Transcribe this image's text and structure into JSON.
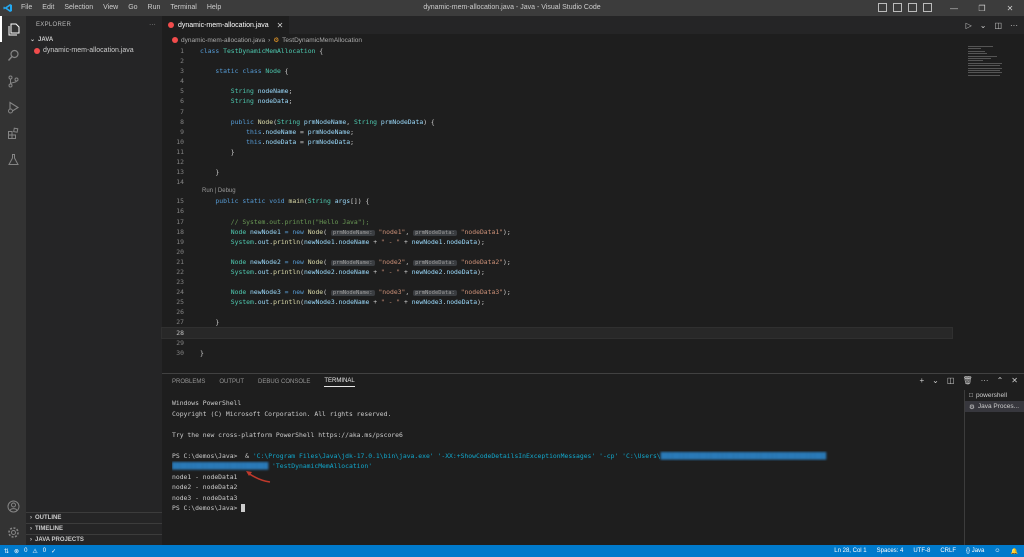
{
  "titlebar": {
    "menu": [
      "File",
      "Edit",
      "Selection",
      "View",
      "Go",
      "Run",
      "Terminal",
      "Help"
    ],
    "title": "dynamic-mem-allocation.java - Java - Visual Studio Code"
  },
  "sidebar": {
    "header": "EXPLORER",
    "section": "JAVA",
    "file": "dynamic-mem-allocation.java",
    "bottom_sections": [
      "OUTLINE",
      "TIMELINE",
      "JAVA PROJECTS"
    ]
  },
  "editor": {
    "tab_label": "dynamic-mem-allocation.java",
    "breadcrumb": [
      "dynamic-mem-allocation.java",
      "TestDynamicMemAllocation"
    ],
    "codelens": "Run | Debug",
    "line_numbers": [
      "1",
      "2",
      "3",
      "4",
      "5",
      "6",
      "7",
      "8",
      "9",
      "10",
      "11",
      "12",
      "13",
      "14",
      "15",
      "16",
      "17",
      "18",
      "19",
      "20",
      "21",
      "22",
      "23",
      "24",
      "25",
      "26",
      "27",
      "28",
      "29",
      "30"
    ],
    "code": {
      "l1a": "class ",
      "l1b": "TestDynamicMemAllocation",
      "l1c": " {",
      "l3a": "    static class ",
      "l3b": "Node",
      "l3c": " {",
      "l5a": "        String ",
      "l5b": "nodeName",
      "l5c": ";",
      "l6a": "        String ",
      "l6b": "nodeData",
      "l6c": ";",
      "l8a": "        public ",
      "l8b": "Node",
      "l8c": "(",
      "l8d": "String ",
      "l8e": "prmNodeName",
      "l8f": ", ",
      "l8g": "String ",
      "l8h": "prmNodeData",
      "l8i": ") {",
      "l9a": "            this",
      "l9b": ".",
      "l9c": "nodeName",
      "l9d": " = ",
      "l9e": "prmNodeName",
      "l9f": ";",
      "l10a": "            this",
      "l10b": ".",
      "l10c": "nodeData",
      "l10d": " = ",
      "l10e": "prmNodeData",
      "l10f": ";",
      "l11": "        }",
      "l13": "    }",
      "l15a": "    public static void ",
      "l15b": "main",
      "l15c": "(",
      "l15d": "String ",
      "l15e": "args",
      "l15f": "[]) {",
      "l17": "        // System.out.println(\"Hello Java\");",
      "hint_name": "prmNodeName:",
      "hint_data": "prmNodeData:",
      "l18a": "        Node ",
      "l18b": "newNode1",
      "l18c": " = new ",
      "l18d": "Node",
      "l18e": "( ",
      "l18f": "\"node1\"",
      "l18g": ", ",
      "l18h": "\"nodeData1\"",
      "l18i": ");",
      "l19a": "        System",
      "l19b": ".",
      "l19c": "out",
      "l19d": ".",
      "l19e": "println",
      "l19f": "(",
      "l19g": "newNode1",
      "l19h": ".",
      "l19i": "nodeName",
      "l19j": " + ",
      "l19k": "\" - \"",
      "l19l": " + ",
      "l19m": "newNode1",
      "l19n": ".",
      "l19o": "nodeData",
      "l19p": ");",
      "l21b": "newNode2",
      "l21f": "\"node2\"",
      "l21h": "\"nodeData2\"",
      "l22g": "newNode2",
      "l22m": "newNode2",
      "l24b": "newNode3",
      "l24f": "\"node3\"",
      "l24h": "\"nodeData3\"",
      "l25g": "newNode3",
      "l25m": "newNode3",
      "l27": "    }",
      "l30": "}"
    }
  },
  "panel": {
    "tabs": [
      "PROBLEMS",
      "OUTPUT",
      "DEBUG CONSOLE",
      "TERMINAL"
    ],
    "terminal_list": [
      "powershell",
      "Java Proces..."
    ],
    "terminal": {
      "l1": "Windows PowerShell",
      "l2": "Copyright (C) Microsoft Corporation. All rights reserved.",
      "l3": "Try the new cross-platform PowerShell https://aka.ms/pscore6",
      "prompt": "PS C:\\demos\\Java>",
      "cmd_amp": "  & ",
      "cmd_java": "'C:\\Program Files\\Java\\jdk-17.0.1\\bin\\java.exe'",
      "cmd_flags": " '-XX:+ShowCodeDetailsInExceptionMessages' '-cp' 'C:\\Users\\",
      "cmd_class": " 'TestDynamicMemAllocation'",
      "out1": "node1 - nodeData1",
      "out2": "node2 - nodeData2",
      "out3": "node3 - nodeData3",
      "prompt2": "PS C:\\demos\\Java> "
    }
  },
  "statusbar": {
    "left": [
      "0",
      "0"
    ],
    "position": "Ln 28, Col 1",
    "spaces": "Spaces: 4",
    "encoding": "UTF-8",
    "eol": "CRLF",
    "language": "Java"
  },
  "colors": {
    "accent": "#007acc",
    "error": "#f14c4c",
    "arrow": "#c0392b"
  }
}
